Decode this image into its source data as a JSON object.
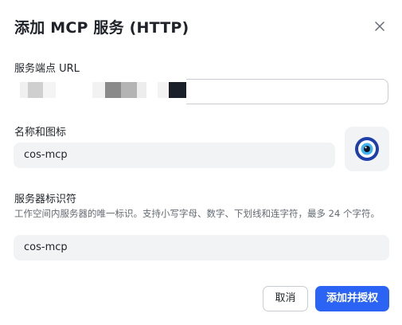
{
  "dialog": {
    "title": "添加 MCP 服务 (HTTP)",
    "close_icon": "close-icon"
  },
  "endpoint": {
    "label": "服务端点 URL",
    "value": ""
  },
  "name_icon": {
    "label": "名称和图标",
    "name_value": "cos-mcp",
    "icon": "evil-eye-icon"
  },
  "server_id": {
    "label": "服务器标识符",
    "help": "工作空间内服务器的唯一标识。支持小写字母、数字、下划线和连字符，最多 24 个字符。",
    "value": "cos-mcp"
  },
  "actions": {
    "cancel_label": "取消",
    "confirm_label": "添加并授权"
  },
  "colors": {
    "primary": "#2b63f5",
    "field_bg": "#f2f3f5",
    "border": "#c9ccd1",
    "help_text": "#646a73"
  }
}
